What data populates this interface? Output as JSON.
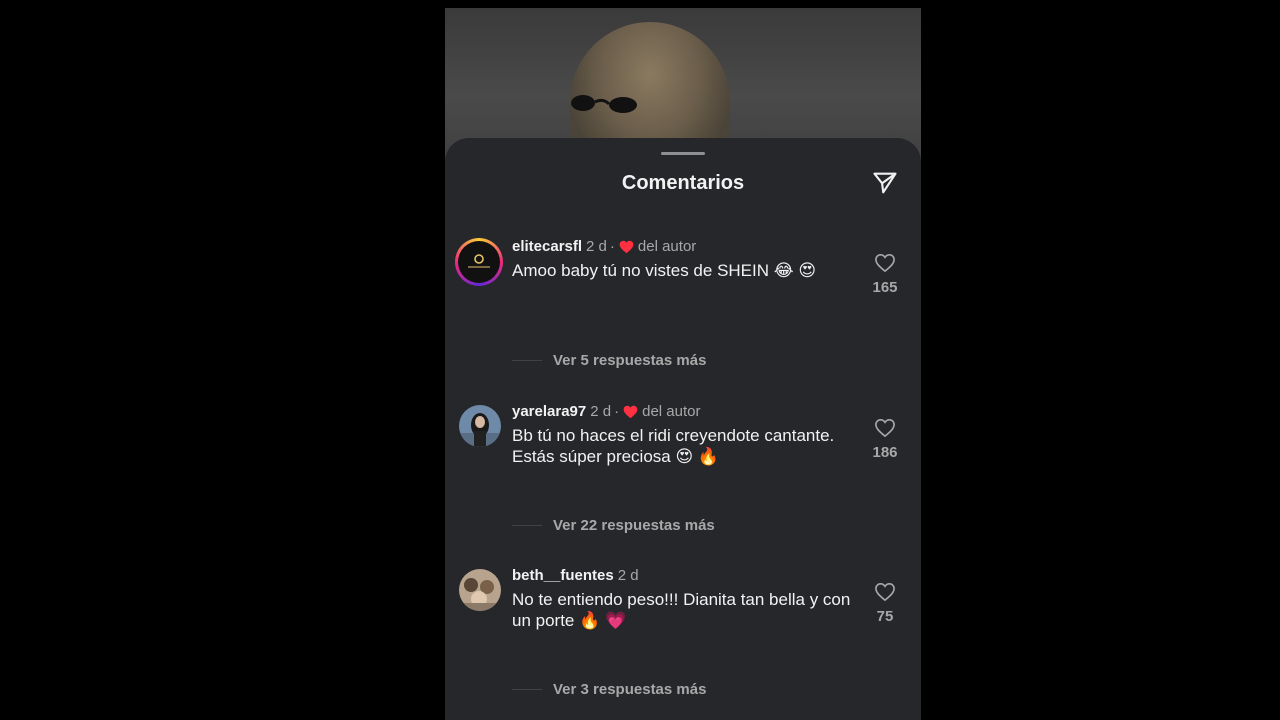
{
  "sheet": {
    "title": "Comentarios",
    "share_icon": "send-icon"
  },
  "comments": [
    {
      "username": "elitecarsfl",
      "time": "2 d",
      "dot": "·",
      "author_badge": "del autor",
      "text": "Amoo baby tú no vistes de SHEIN 😂 😍",
      "likes": "165",
      "replies": "Ver 5 respuestas más",
      "avatar_icon": "elite-cars-logo"
    },
    {
      "username": "yarelara97",
      "time": "2 d",
      "dot": "·",
      "author_badge": "del autor",
      "text": "Bb tú no haces el ridi creyendote cantante. Estás súper preciosa 😍 🔥",
      "likes": "186",
      "replies": "Ver 22 respuestas más",
      "avatar_icon": "user-avatar"
    },
    {
      "username": "beth__fuentes",
      "time": "2 d",
      "text": "No te entiendo peso!!! Dianita tan bella y con un porte 🔥 💗",
      "likes": "75",
      "replies": "Ver 3 respuestas más",
      "avatar_icon": "user-avatar"
    }
  ],
  "colors": {
    "sheet_bg": "#25272b",
    "heart_red": "#ff3040",
    "muted_text": "#a8a8a8"
  }
}
